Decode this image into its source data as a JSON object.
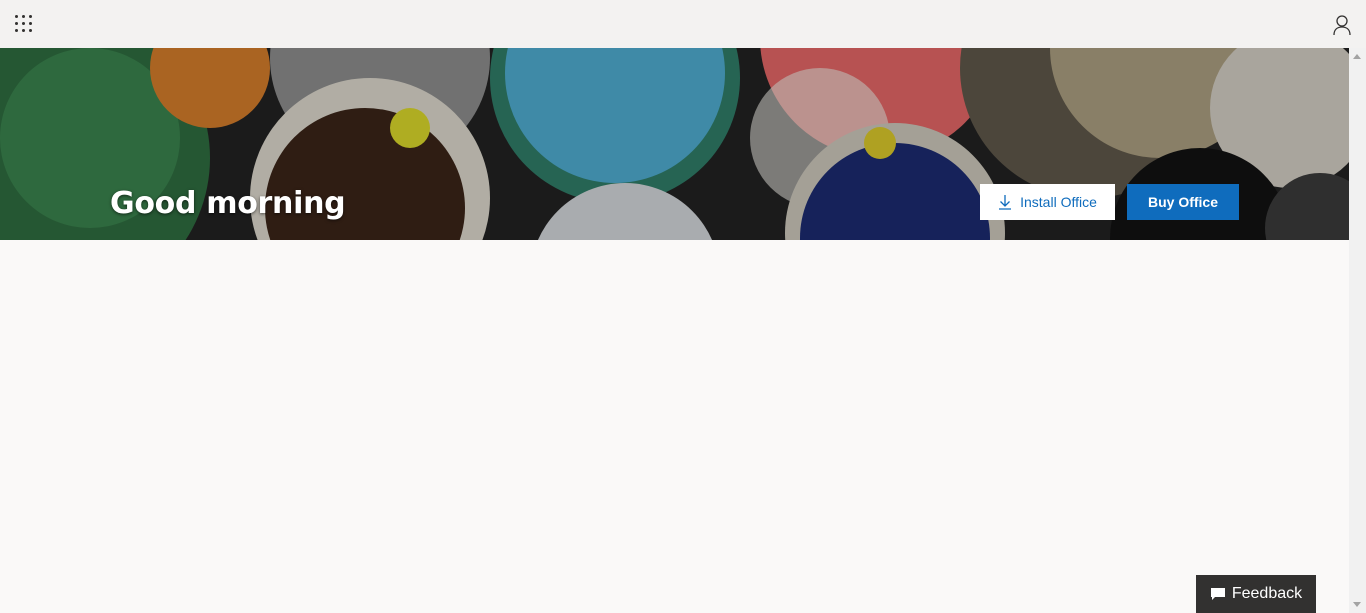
{
  "header": {
    "app_launcher_icon": "waffle-icon",
    "profile_icon": "person-icon"
  },
  "hero": {
    "greeting": "Good morning",
    "install_label": "Install Office",
    "install_icon": "download-icon",
    "buy_label": "Buy Office",
    "accent_color": "#0f6cbd"
  },
  "feedback": {
    "label": "Feedback",
    "icon": "chat-bubble-icon"
  }
}
